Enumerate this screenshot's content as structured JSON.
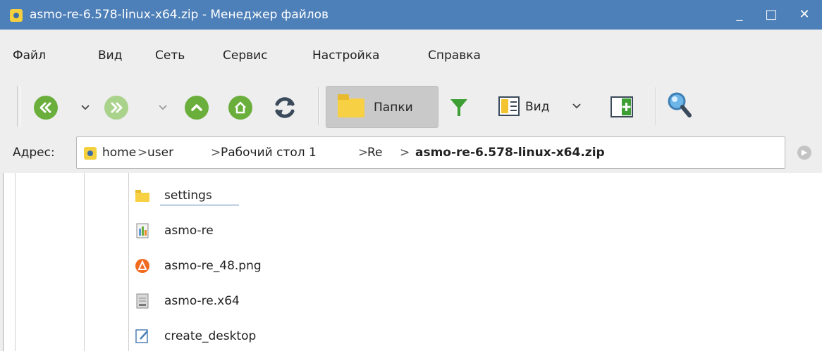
{
  "window": {
    "title": "asmo-re-6.578-linux-x64.zip - Менеджер файлов",
    "minimize": "_",
    "maximize": "□",
    "close": "✕"
  },
  "menu": [
    "Файл",
    "Вид",
    "Сеть",
    "Сервис",
    "Настройка",
    "Справка"
  ],
  "toolbar": {
    "folders_label": "Папки",
    "view_label": "Вид",
    "icons": [
      "back-icon",
      "forward-icon",
      "up-icon",
      "home-icon",
      "refresh-icon",
      "folders-icon",
      "filter-icon",
      "view-icon",
      "panel-icon",
      "search-icon"
    ]
  },
  "address": {
    "label": "Адрес:",
    "crumbs": [
      "home",
      "user",
      "Рабочий стол 1",
      "Re",
      "asmo-re-6.578-linux-x64.zip"
    ],
    "separator": ">"
  },
  "files": [
    {
      "name": "settings",
      "icon": "folder-icon"
    },
    {
      "name": "asmo-re",
      "icon": "executable-icon"
    },
    {
      "name": "asmo-re_48.png",
      "icon": "image-icon"
    },
    {
      "name": "asmo-re.x64",
      "icon": "binary-icon"
    },
    {
      "name": "create_desktop",
      "icon": "script-icon"
    }
  ],
  "colors": {
    "titlebar": "#4d7fb8",
    "nav_green": "#6aae3b",
    "nav_green_disabled": "#a9d28a",
    "filter_green": "#3d9e34",
    "folder_yellow": "#f7d043"
  }
}
